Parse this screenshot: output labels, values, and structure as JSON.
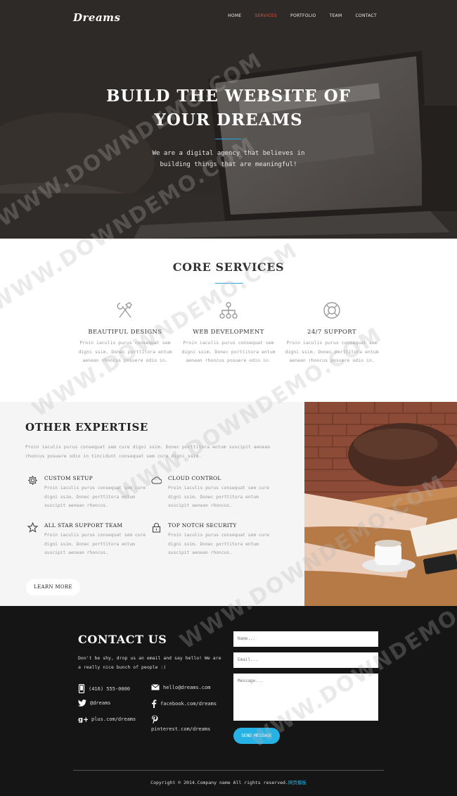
{
  "brand": {
    "logo": "Dreams"
  },
  "nav": {
    "items": [
      "HOME",
      "SERVICES",
      "PORTFOLIO",
      "TEAM",
      "CONTACT"
    ],
    "active_index": 1,
    "active_color": "#e0523c"
  },
  "hero": {
    "title_line1": "BUILD THE WEBSITE OF",
    "title_line2": "YOUR DREAMS",
    "subtitle_line1": "We are a digital agency that believes in",
    "subtitle_line2": "building things that are meaningful!"
  },
  "core": {
    "title": "CORE SERVICES",
    "services": [
      {
        "icon": "tools-icon",
        "title": "BEAUTIFUL DESIGNS",
        "text": "Proin iaculis purus consequat sem digni ssim. Donec porttitora entum aenean rhoncus posuere odio in."
      },
      {
        "icon": "sitemap-icon",
        "title": "WEB DEVELOPMENT",
        "text": "Proin iaculis purus consequat sem digni ssim. Donec porttitora entum aenean rhoncus posuere odio in."
      },
      {
        "icon": "lifebuoy-icon",
        "title": "24/7 SUPPORT",
        "text": "Proin iaculis purus consequat sem digni ssim. Donec porttitora entum aenean rhoncus posuere odio in."
      }
    ]
  },
  "expertise": {
    "title": "OTHER EXPERTISE",
    "intro": "Proin iaculis purus consequat sem cure digni ssim. Donec porttitora entum suscipit aenean rhoncus posuere odio in tincidunt consequat sem cure digni ssim.",
    "features": [
      {
        "icon": "gear-icon",
        "title": "CUSTOM SETUP",
        "text": "Proin iaculis purus consequat sem cure digni ssim. Donec porttitora entum suscipit aenean rhoncus."
      },
      {
        "icon": "cloud-icon",
        "title": "CLOUD CONTROL",
        "text": "Proin iaculis purus consequat sem cure digni ssim. Donec porttitora entum suscipit aenean rhoncus."
      },
      {
        "icon": "star-icon",
        "title": "ALL STAR SUPPORT TEAM",
        "text": "Proin iaculis purus consequat sem cure digni ssim. Donec porttitora entum suscipit aenean rhoncus."
      },
      {
        "icon": "lock-icon",
        "title": "TOP NOTCH SECURITY",
        "text": "Proin iaculis purus consequat sem cure digni ssim. Donec porttitora entum suscipit aenean rhoncus."
      }
    ],
    "button": "LEARN MORE"
  },
  "contact": {
    "title": "CONTACT US",
    "text": "Don't be shy, drop us an email and say hello! We are a really nice bunch of people :)",
    "phone": "(416) 555-0000",
    "email": "hello@dreams.com",
    "twitter": "@dreams",
    "facebook": "facebook.com/dreams",
    "gplus": "plus.com/dreams",
    "pinterest": "pinterest.com/dreams",
    "form": {
      "name_placeholder": "Name...",
      "email_placeholder": "Email...",
      "message_placeholder": "Message...",
      "send": "SEND MESSAGE"
    },
    "accent": "#27b2e6"
  },
  "footer": {
    "copyright": "Copyright © 2014.Company name All rights reserved.",
    "link": "网页模板"
  },
  "watermark": "WWW.DOWNDEMO.COM"
}
